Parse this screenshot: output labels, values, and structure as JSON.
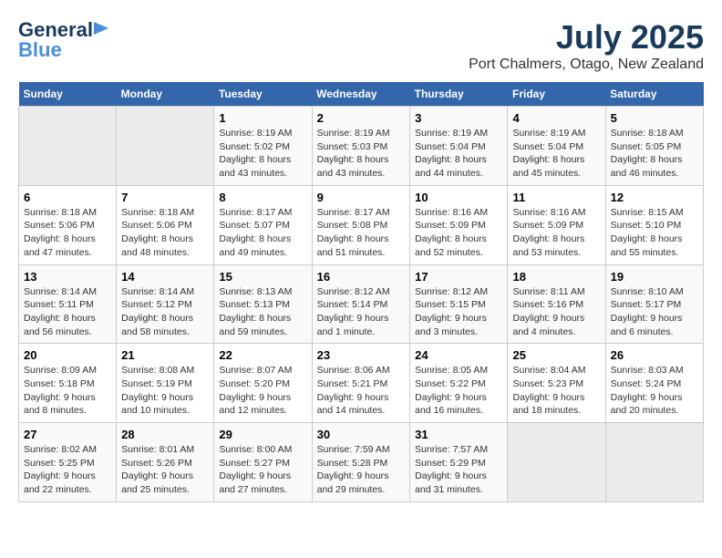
{
  "header": {
    "logo_general": "General",
    "logo_blue": "Blue",
    "title": "July 2025",
    "subtitle": "Port Chalmers, Otago, New Zealand"
  },
  "days_of_week": [
    "Sunday",
    "Monday",
    "Tuesday",
    "Wednesday",
    "Thursday",
    "Friday",
    "Saturday"
  ],
  "weeks": [
    [
      {
        "num": "",
        "info": ""
      },
      {
        "num": "",
        "info": ""
      },
      {
        "num": "1",
        "info": "Sunrise: 8:19 AM\nSunset: 5:02 PM\nDaylight: 8 hours and 43 minutes."
      },
      {
        "num": "2",
        "info": "Sunrise: 8:19 AM\nSunset: 5:03 PM\nDaylight: 8 hours and 43 minutes."
      },
      {
        "num": "3",
        "info": "Sunrise: 8:19 AM\nSunset: 5:04 PM\nDaylight: 8 hours and 44 minutes."
      },
      {
        "num": "4",
        "info": "Sunrise: 8:19 AM\nSunset: 5:04 PM\nDaylight: 8 hours and 45 minutes."
      },
      {
        "num": "5",
        "info": "Sunrise: 8:18 AM\nSunset: 5:05 PM\nDaylight: 8 hours and 46 minutes."
      }
    ],
    [
      {
        "num": "6",
        "info": "Sunrise: 8:18 AM\nSunset: 5:06 PM\nDaylight: 8 hours and 47 minutes."
      },
      {
        "num": "7",
        "info": "Sunrise: 8:18 AM\nSunset: 5:06 PM\nDaylight: 8 hours and 48 minutes."
      },
      {
        "num": "8",
        "info": "Sunrise: 8:17 AM\nSunset: 5:07 PM\nDaylight: 8 hours and 49 minutes."
      },
      {
        "num": "9",
        "info": "Sunrise: 8:17 AM\nSunset: 5:08 PM\nDaylight: 8 hours and 51 minutes."
      },
      {
        "num": "10",
        "info": "Sunrise: 8:16 AM\nSunset: 5:09 PM\nDaylight: 8 hours and 52 minutes."
      },
      {
        "num": "11",
        "info": "Sunrise: 8:16 AM\nSunset: 5:09 PM\nDaylight: 8 hours and 53 minutes."
      },
      {
        "num": "12",
        "info": "Sunrise: 8:15 AM\nSunset: 5:10 PM\nDaylight: 8 hours and 55 minutes."
      }
    ],
    [
      {
        "num": "13",
        "info": "Sunrise: 8:14 AM\nSunset: 5:11 PM\nDaylight: 8 hours and 56 minutes."
      },
      {
        "num": "14",
        "info": "Sunrise: 8:14 AM\nSunset: 5:12 PM\nDaylight: 8 hours and 58 minutes."
      },
      {
        "num": "15",
        "info": "Sunrise: 8:13 AM\nSunset: 5:13 PM\nDaylight: 8 hours and 59 minutes."
      },
      {
        "num": "16",
        "info": "Sunrise: 8:12 AM\nSunset: 5:14 PM\nDaylight: 9 hours and 1 minute."
      },
      {
        "num": "17",
        "info": "Sunrise: 8:12 AM\nSunset: 5:15 PM\nDaylight: 9 hours and 3 minutes."
      },
      {
        "num": "18",
        "info": "Sunrise: 8:11 AM\nSunset: 5:16 PM\nDaylight: 9 hours and 4 minutes."
      },
      {
        "num": "19",
        "info": "Sunrise: 8:10 AM\nSunset: 5:17 PM\nDaylight: 9 hours and 6 minutes."
      }
    ],
    [
      {
        "num": "20",
        "info": "Sunrise: 8:09 AM\nSunset: 5:18 PM\nDaylight: 9 hours and 8 minutes."
      },
      {
        "num": "21",
        "info": "Sunrise: 8:08 AM\nSunset: 5:19 PM\nDaylight: 9 hours and 10 minutes."
      },
      {
        "num": "22",
        "info": "Sunrise: 8:07 AM\nSunset: 5:20 PM\nDaylight: 9 hours and 12 minutes."
      },
      {
        "num": "23",
        "info": "Sunrise: 8:06 AM\nSunset: 5:21 PM\nDaylight: 9 hours and 14 minutes."
      },
      {
        "num": "24",
        "info": "Sunrise: 8:05 AM\nSunset: 5:22 PM\nDaylight: 9 hours and 16 minutes."
      },
      {
        "num": "25",
        "info": "Sunrise: 8:04 AM\nSunset: 5:23 PM\nDaylight: 9 hours and 18 minutes."
      },
      {
        "num": "26",
        "info": "Sunrise: 8:03 AM\nSunset: 5:24 PM\nDaylight: 9 hours and 20 minutes."
      }
    ],
    [
      {
        "num": "27",
        "info": "Sunrise: 8:02 AM\nSunset: 5:25 PM\nDaylight: 9 hours and 22 minutes."
      },
      {
        "num": "28",
        "info": "Sunrise: 8:01 AM\nSunset: 5:26 PM\nDaylight: 9 hours and 25 minutes."
      },
      {
        "num": "29",
        "info": "Sunrise: 8:00 AM\nSunset: 5:27 PM\nDaylight: 9 hours and 27 minutes."
      },
      {
        "num": "30",
        "info": "Sunrise: 7:59 AM\nSunset: 5:28 PM\nDaylight: 9 hours and 29 minutes."
      },
      {
        "num": "31",
        "info": "Sunrise: 7:57 AM\nSunset: 5:29 PM\nDaylight: 9 hours and 31 minutes."
      },
      {
        "num": "",
        "info": ""
      },
      {
        "num": "",
        "info": ""
      }
    ]
  ]
}
